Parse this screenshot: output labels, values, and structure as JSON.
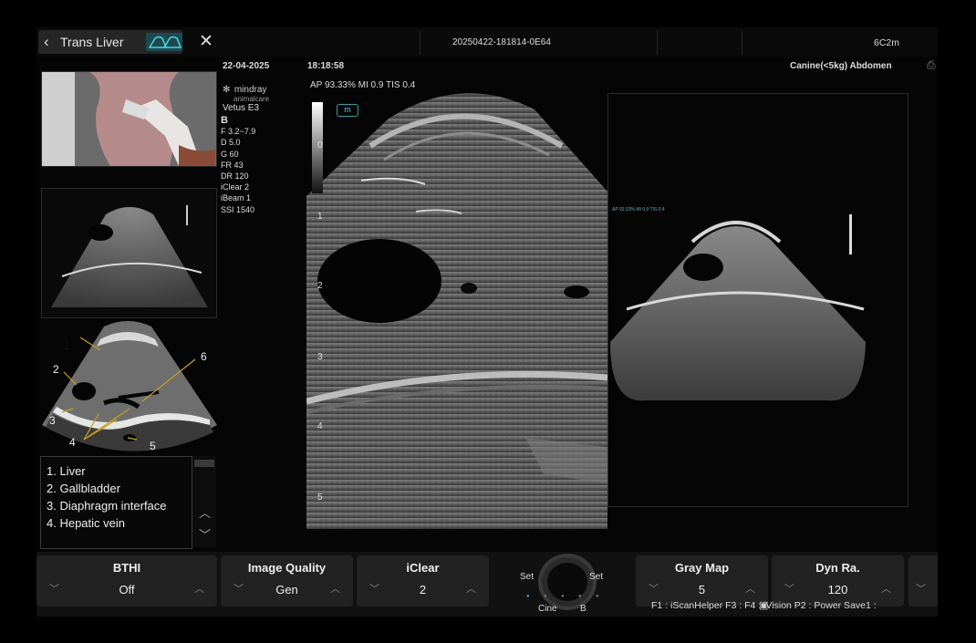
{
  "header": {
    "preset_label": "Trans Liver",
    "file_id": "20250422-181814-0E64",
    "probe": "6C2m",
    "date": "22-04-2025",
    "time": "18:18:58",
    "exam_type": "Canine(<5kg) Abdomen",
    "acoustic": "AP 93.33%  MI 0.9  TIS 0.4"
  },
  "brand": {
    "name": "mindray",
    "sub": "animalcare",
    "model": "Vetus E3"
  },
  "params": [
    "B",
    "F 3.2~7.9",
    "D 5.0",
    "G 60",
    "FR 43",
    "DR 120",
    "iClear 2",
    "iBeam 1",
    "SSI 1540"
  ],
  "depth_ticks": [
    "0",
    "1",
    "2",
    "3",
    "4",
    "5"
  ],
  "marker_label": "m",
  "diagram_numbers": [
    "1",
    "2",
    "3",
    "4",
    "5",
    "6"
  ],
  "legend": [
    "1. Liver",
    "2. Gallbladder",
    "3. Diaphragm interface",
    "4. Hepatic vein"
  ],
  "controls": [
    {
      "title": "BTHI",
      "value": "Off"
    },
    {
      "title": "Image Quality",
      "value": "Gen"
    },
    {
      "title": "iClear",
      "value": "2"
    },
    {
      "title": "Gray Map",
      "value": "5"
    },
    {
      "title": "Dyn Ra.",
      "value": "120"
    }
  ],
  "trackball": {
    "left": "Set",
    "right": "Set",
    "cine": "Cine",
    "b": "B"
  },
  "fkeys": "F1 : iScanHelper   F3 :       F4 : iVision   P2 : Power   Save1 :",
  "colors": {
    "accent": "#1d4a50",
    "annotation": "#c8a020"
  }
}
